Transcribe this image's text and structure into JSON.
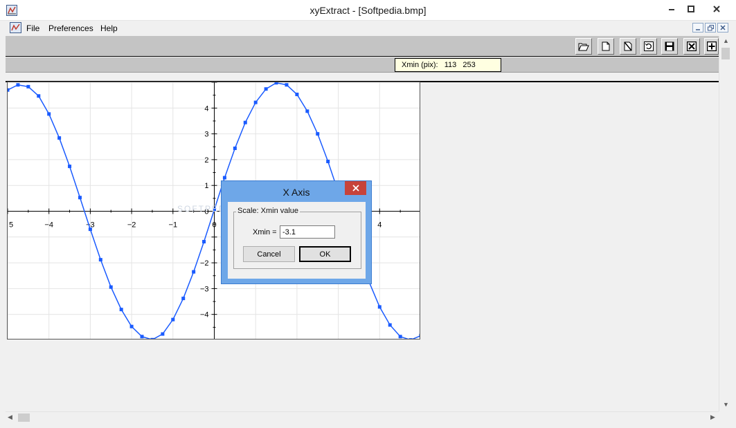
{
  "window": {
    "title": "xyExtract - [Softpedia.bmp]",
    "icons": [
      "app-icon",
      "minimize-icon",
      "maximize-icon",
      "close-icon"
    ]
  },
  "menu": {
    "items": [
      "File",
      "Preferences",
      "Help"
    ],
    "mdi_icons": [
      "mdi-minimize-icon",
      "mdi-restore-icon",
      "mdi-close-icon"
    ]
  },
  "toolbar": {
    "buttons": [
      "open-folder-icon",
      "new-document-icon",
      "clear-document-icon",
      "refresh-icon",
      "save-icon",
      "delete-icon",
      "add-icon"
    ]
  },
  "status": {
    "xmin_readout": "Xmin (pix):   113   253"
  },
  "chart_data": {
    "type": "line",
    "function": "sine curve, amplitude ~4.9",
    "xlim": [
      -5,
      5
    ],
    "ylim": [
      -5,
      5
    ],
    "xticks_visible": [
      "5",
      "−4",
      "−3",
      "−2",
      "−1",
      "0",
      "4"
    ],
    "yticks_visible": [
      "4",
      "3",
      "2",
      "1",
      "0",
      "−2",
      "−3",
      "−4"
    ],
    "grid": true,
    "series": [
      {
        "color": "#1a5bff",
        "x": [
          -5.0,
          -4.75,
          -4.5,
          -4.25,
          -4.0,
          -3.75,
          -3.5,
          -3.25,
          -3.0,
          -2.75,
          -2.5,
          -2.25,
          -2.0,
          -1.75,
          -1.5,
          -1.25,
          -1.0,
          -0.75,
          -0.5,
          -0.25,
          0.0,
          0.25,
          0.5,
          0.75,
          1.0,
          1.25,
          1.5,
          1.75,
          2.0,
          2.25,
          2.5,
          2.75,
          3.0,
          3.25,
          3.5,
          3.75,
          4.0,
          4.25,
          4.5,
          4.75,
          5.0
        ],
        "y": [
          4.7,
          4.9,
          4.83,
          4.47,
          3.77,
          2.84,
          1.74,
          0.53,
          -0.7,
          -1.88,
          -2.94,
          -3.81,
          -4.47,
          -4.86,
          -4.98,
          -4.76,
          -4.2,
          -3.38,
          -2.35,
          -1.18,
          0.06,
          1.3,
          2.44,
          3.44,
          4.22,
          4.74,
          4.98,
          4.9,
          4.53,
          3.88,
          3.0,
          1.93,
          0.74,
          -0.47,
          -1.66,
          -2.76,
          -3.71,
          -4.41,
          -4.86,
          -4.99,
          -4.82
        ]
      }
    ]
  },
  "dialog": {
    "title": "X Axis",
    "group_label": "Scale: Xmin value",
    "xmin_label": "Xmin =",
    "xmin_value": "-3.1",
    "cancel_label": "Cancel",
    "ok_label": "OK"
  },
  "watermark": "SOFTPEDIA"
}
